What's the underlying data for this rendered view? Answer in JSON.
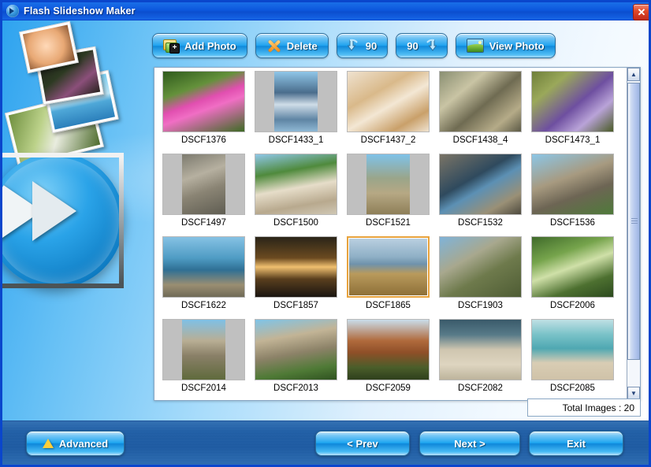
{
  "window": {
    "title": "Flash Slideshow Maker",
    "icon": "app-globe-icon",
    "close_label": "✕",
    "accent": "#0c57dd",
    "button_accent": "#1ea2ef",
    "selection_color": "#e8a33d"
  },
  "toolbar": {
    "buttons": [
      {
        "label": "Add Photo",
        "icon": "add-photo-folder-icon"
      },
      {
        "label": "Delete",
        "icon": "delete-x-icon"
      },
      {
        "label": "90",
        "icon": "rotate-left-90-icon"
      },
      {
        "label": "90",
        "icon": "rotate-right-90-icon"
      },
      {
        "label": "View Photo",
        "icon": "view-photo-picture-icon"
      }
    ]
  },
  "photo_list": {
    "items": [
      {
        "name": "DSCF1376",
        "orientation": "landscape"
      },
      {
        "name": "DSCF1433_1",
        "orientation": "portrait"
      },
      {
        "name": "DSCF1437_2",
        "orientation": "landscape"
      },
      {
        "name": "DSCF1438_4",
        "orientation": "landscape"
      },
      {
        "name": "DSCF1473_1",
        "orientation": "landscape"
      },
      {
        "name": "DSCF1497",
        "orientation": "portrait"
      },
      {
        "name": "DSCF1500",
        "orientation": "landscape"
      },
      {
        "name": "DSCF1521",
        "orientation": "portrait"
      },
      {
        "name": "DSCF1532",
        "orientation": "landscape"
      },
      {
        "name": "DSCF1536",
        "orientation": "landscape"
      },
      {
        "name": "DSCF1622",
        "orientation": "landscape"
      },
      {
        "name": "DSCF1857",
        "orientation": "landscape"
      },
      {
        "name": "DSCF1865",
        "orientation": "landscape",
        "selected": true
      },
      {
        "name": "DSCF1903",
        "orientation": "landscape"
      },
      {
        "name": "DSCF2006",
        "orientation": "landscape"
      },
      {
        "name": "DSCF2014",
        "orientation": "portrait"
      },
      {
        "name": "DSCF2013",
        "orientation": "landscape"
      },
      {
        "name": "DSCF2059",
        "orientation": "landscape"
      },
      {
        "name": "DSCF2082",
        "orientation": "landscape"
      },
      {
        "name": "DSCF2085",
        "orientation": "landscape"
      }
    ]
  },
  "scrollbar": {
    "up_arrow": "▲",
    "down_arrow": "▼"
  },
  "status": {
    "total_images": "Total Images : 20"
  },
  "footer": {
    "advanced": "Advanced",
    "prev": "< Prev",
    "next": "Next >",
    "exit": "Exit"
  }
}
